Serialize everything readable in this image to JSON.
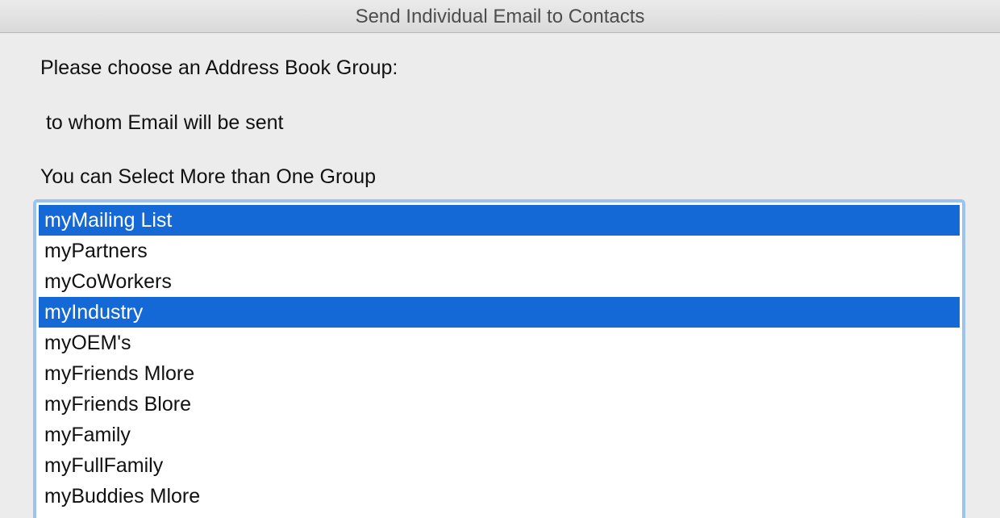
{
  "window": {
    "title": "Send Individual Email to Contacts"
  },
  "prompts": {
    "line1": "Please choose an Address Book Group:",
    "line2": " to whom Email will be sent",
    "line3": "You can Select More than One Group"
  },
  "groups": [
    {
      "label": "myMailing List",
      "selected": true
    },
    {
      "label": "myPartners",
      "selected": false
    },
    {
      "label": "myCoWorkers",
      "selected": false
    },
    {
      "label": "myIndustry",
      "selected": true
    },
    {
      "label": "myOEM's",
      "selected": false
    },
    {
      "label": "myFriends Mlore",
      "selected": false
    },
    {
      "label": "myFriends Blore",
      "selected": false
    },
    {
      "label": "myFamily",
      "selected": false
    },
    {
      "label": "myFullFamily",
      "selected": false
    },
    {
      "label": "myBuddies Mlore",
      "selected": false
    }
  ],
  "colors": {
    "selection": "#1469d7",
    "focus_ring": "#9cc3ee"
  }
}
